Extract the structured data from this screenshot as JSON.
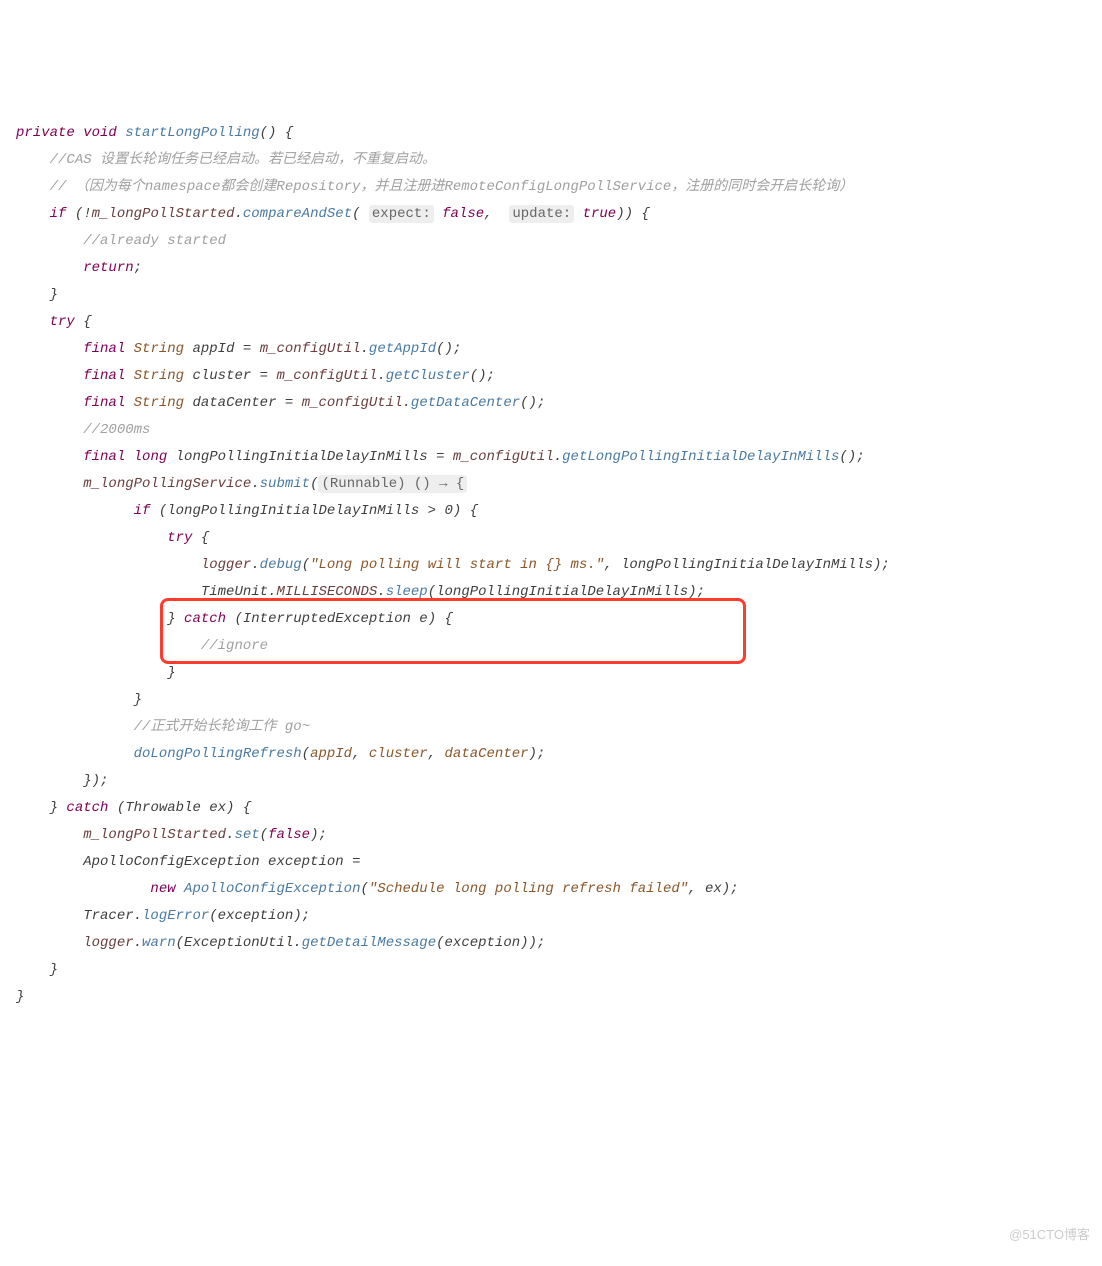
{
  "code": {
    "l1a": "private",
    "l1b": "void",
    "l1c": "startLongPolling",
    "l1d": "() {",
    "l2": "//CAS 设置长轮询任务已经启动。若已经启动，不重复启动。",
    "l3": "// （因为每个namespace都会创建Repository，并且注册进RemoteConfigLongPollService，注册的同时会开启长轮询）",
    "l4a": "if",
    "l4b": "(!",
    "l4c": "m_longPollStarted",
    "l4d": ".",
    "l4e": "compareAndSet",
    "l4f": "(",
    "l4g": "expect:",
    "l4h": "false",
    "l4i": ", ",
    "l4j": "update:",
    "l4k": "true",
    "l4l": ")) {",
    "l5": "//already started",
    "l6a": "return",
    "l6b": ";",
    "l7": "}",
    "l8a": "try",
    "l8b": " {",
    "l9a": "final",
    "l9b": "String",
    "l9c": "appId = ",
    "l9d": "m_configUtil",
    "l9e": ".",
    "l9f": "getAppId",
    "l9g": "();",
    "l10a": "final",
    "l10b": "String",
    "l10c": "cluster = ",
    "l10d": "m_configUtil",
    "l10e": ".",
    "l10f": "getCluster",
    "l10g": "();",
    "l11a": "final",
    "l11b": "String",
    "l11c": "dataCenter = ",
    "l11d": "m_configUtil",
    "l11e": ".",
    "l11f": "getDataCenter",
    "l11g": "();",
    "l12": "//2000ms",
    "l13a": "final",
    "l13b": "long",
    "l13c": "longPollingInitialDelayInMills = ",
    "l13d": "m_configUtil",
    "l13e": ".",
    "l13f": "getLongPollingInitialDelayInMills",
    "l13g": "();",
    "l14a": "m_longPollingService",
    "l14b": ".",
    "l14c": "submit",
    "l14d": "(",
    "l14e": "(Runnable) () → {",
    "l15a": "if",
    "l15b": " (longPollingInitialDelayInMills > 0) {",
    "l16a": "try",
    "l16b": " {",
    "l17a": "logger",
    "l17b": ".",
    "l17c": "debug",
    "l17d": "(",
    "l17e": "\"Long polling will start in {} ms.\"",
    "l17f": ", longPollingInitialDelayInMills);",
    "l18a": "TimeUnit.",
    "l18b": "MILLISECONDS",
    "l18c": ".",
    "l18d": "sleep",
    "l18e": "(longPollingInitialDelayInMills);",
    "l19a": "} ",
    "l19b": "catch",
    "l19c": " (InterruptedException e) {",
    "l20": "//ignore",
    "l21": "}",
    "l22": "}",
    "l23": "//正式开始长轮询工作 go~",
    "l24a": "doLongPollingRefresh",
    "l24b": "(",
    "l24c": "appId",
    "l24d": ", ",
    "l24e": "cluster",
    "l24f": ", ",
    "l24g": "dataCenter",
    "l24h": ");",
    "l25": "});",
    "l26a": "} ",
    "l26b": "catch",
    "l26c": " (Throwable ex) {",
    "l27a": "m_longPollStarted",
    "l27b": ".",
    "l27c": "set",
    "l27d": "(",
    "l27e": "false",
    "l27f": ");",
    "l28a": "ApolloConfigException exception =",
    "l29a": "new",
    "l29b": "ApolloConfigException",
    "l29c": "(",
    "l29d": "\"Schedule long polling refresh failed\"",
    "l29e": ", ex);",
    "l30a": "Tracer.",
    "l30b": "logError",
    "l30c": "(exception);",
    "l31a": "logger",
    "l31b": ".",
    "l31c": "warn",
    "l31d": "(ExceptionUtil.",
    "l31e": "getDetailMessage",
    "l31f": "(exception));",
    "l32": "}",
    "l33": "}"
  },
  "watermark": "@51CTO博客"
}
